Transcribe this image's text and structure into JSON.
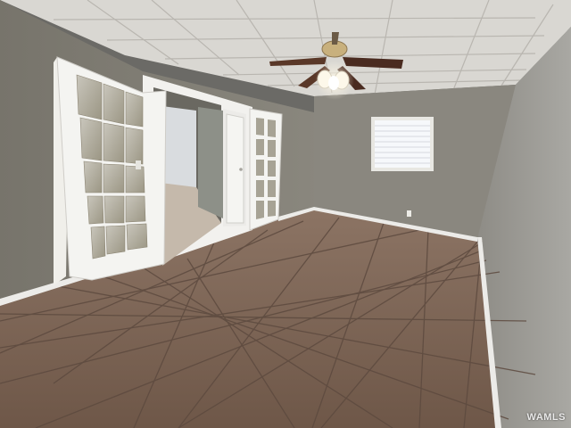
{
  "watermark": "WAMLS",
  "colors": {
    "ceiling": "#dcdad6",
    "wall_left": "#807d74",
    "wall_back": "#8b8880",
    "wall_right": "#9a9994",
    "floor": "#7d6555",
    "grout": "#5e4b40",
    "baseboard": "#e9e9e6",
    "door_white": "#f2f2ef",
    "window_light": "#f5f7fa"
  },
  "objects": {
    "ceiling_fan": "ceiling-fan-with-light",
    "window": "window-with-blinds",
    "french_doors": "french-doors-15-pane",
    "doorway": "open-doorway-to-hall",
    "floor": "ceramic-tile-floor"
  }
}
